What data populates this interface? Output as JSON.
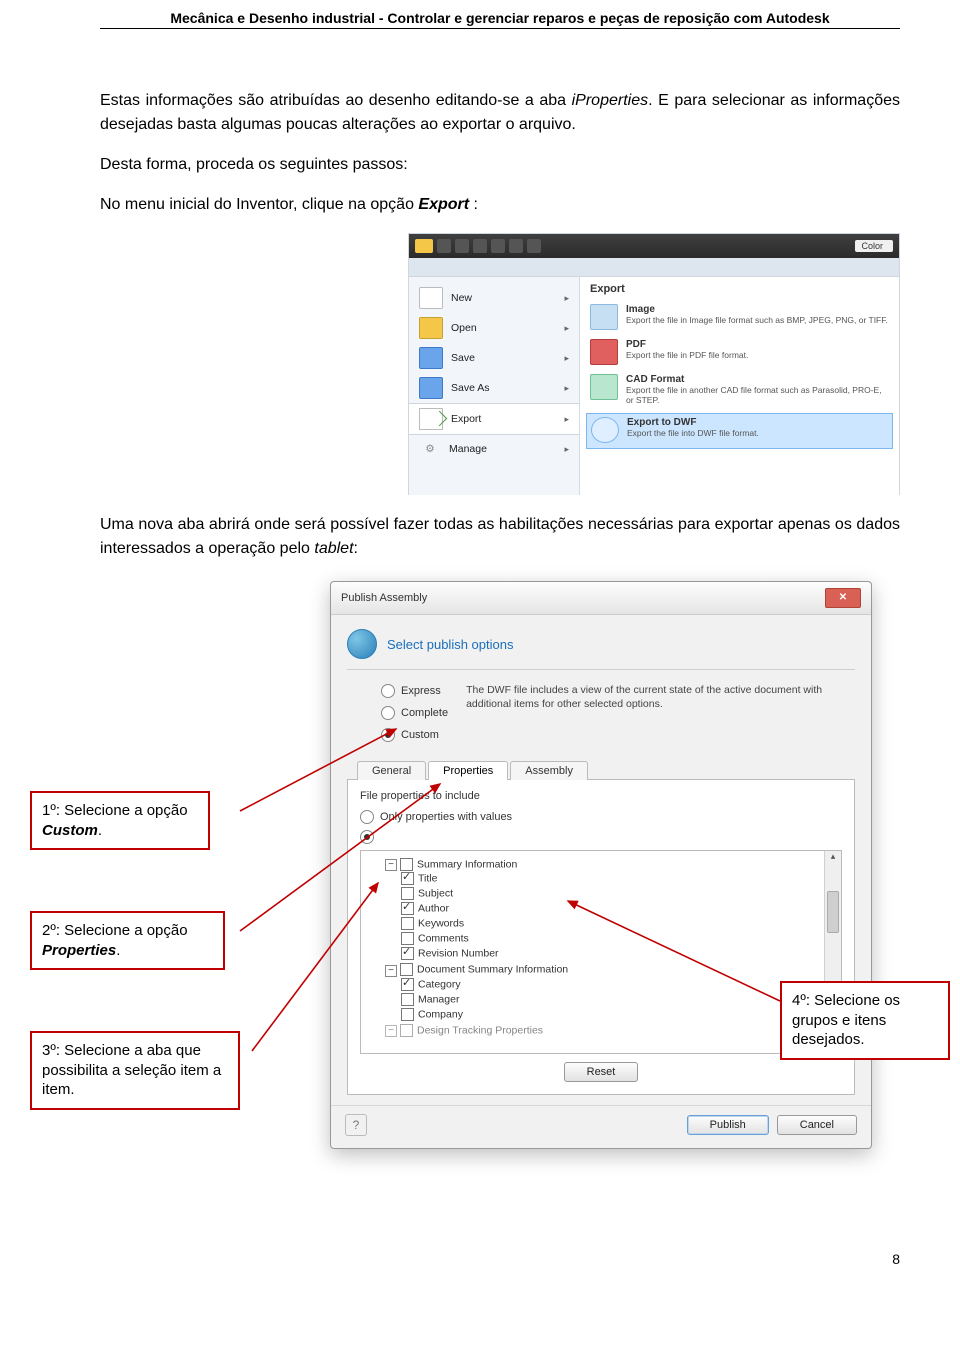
{
  "header": "Mecânica e Desenho industrial - Controlar e gerenciar reparos e peças de reposição com Autodesk",
  "para1_a": "Estas informações são atribuídas ao desenho editando-se a aba ",
  "para1_b": "iProperties",
  "para1_c": ". E para selecionar as informações desejadas basta algumas poucas alterações ao exportar o arquivo.",
  "para2": "Desta forma, proceda os seguintes passos:",
  "para3_a": "No menu inicial do Inventor, clique na opção ",
  "para3_b": "Export",
  "para3_c": " :",
  "para4_a": "Uma nova aba abrirá onde será possível fazer todas as habilitações necessárias para exportar apenas os dados interessados a operação pelo ",
  "para4_b": "tablet",
  "para4_c": ":",
  "inventor": {
    "topColor": "Color",
    "file": {
      "new": "New",
      "open": "Open",
      "save": "Save",
      "saveas": "Save As",
      "export": "Export",
      "manage": "Manage"
    },
    "panelTitle": "Export",
    "items": {
      "img": {
        "title": "Image",
        "desc": "Export the file in Image file format such as BMP, JPEG, PNG, or TIFF."
      },
      "pdf": {
        "title": "PDF",
        "desc": "Export the file in PDF file format."
      },
      "cad": {
        "title": "CAD Format",
        "desc": "Export the file in another CAD file format such as Parasolid, PRO-E, or STEP."
      },
      "dwf": {
        "title": "Export to DWF",
        "desc": "Export the file into DWF file format."
      }
    }
  },
  "dlg": {
    "title": "Publish Assembly",
    "selectHeading": "Select publish options",
    "express": "Express",
    "complete": "Complete",
    "custom": "Custom",
    "dwfdesc": "The DWF file includes a view of the current state of the active document with additional items for other selected options.",
    "tabGeneral": "General",
    "tabProperties": "Properties",
    "tabAssembly": "Assembly",
    "sub": "File properties to include",
    "onlyVals": "Only properties with values",
    "tree": {
      "summary": "Summary Information",
      "title": "Title",
      "subject": "Subject",
      "author": "Author",
      "keywords": "Keywords",
      "comments": "Comments",
      "revision": "Revision Number",
      "docsummary": "Document Summary Information",
      "category": "Category",
      "manager": "Manager",
      "company": "Company",
      "tracking": "Design Tracking Properties"
    },
    "reset": "Reset",
    "publish": "Publish",
    "cancel": "Cancel"
  },
  "callouts": {
    "c1a": "1º: Selecione a opção ",
    "c1b": "Custom",
    "c1c": ".",
    "c2a": "2º: Selecione a opção ",
    "c2b": "Properties",
    "c2c": ".",
    "c3": "3º: Selecione a aba que possibilita a seleção item a item.",
    "c4": "4º: Selecione os grupos e itens desejados."
  },
  "pageNumber": "8"
}
